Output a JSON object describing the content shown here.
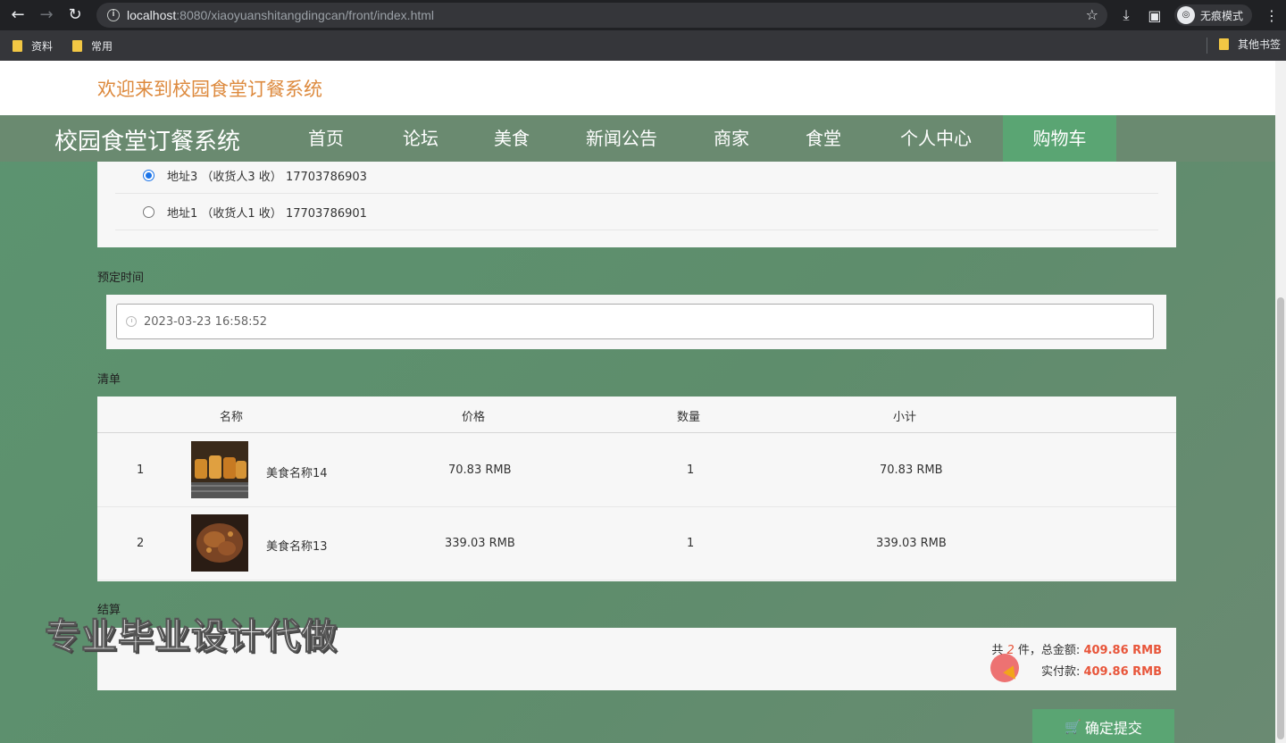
{
  "browser": {
    "url_host": "localhost",
    "url_rest": ":8080/xiaoyuanshitangdingcan/front/index.html",
    "incognito_label": "无痕模式",
    "bookmarks": [
      "资料",
      "常用"
    ],
    "other_bookmarks": "其他书签"
  },
  "header": {
    "welcome": "欢迎来到校园食堂订餐系统",
    "site_title": "校园食堂订餐系统",
    "nav": [
      "首页",
      "论坛",
      "美食",
      "新闻公告",
      "商家",
      "食堂",
      "个人中心",
      "购物车"
    ],
    "active_nav": "购物车"
  },
  "addresses": [
    {
      "text": "地址3 （收货人3 收） 17703786903",
      "selected": true
    },
    {
      "text": "地址1 （收货人1 收） 17703786901",
      "selected": false
    }
  ],
  "booking": {
    "label": "预定时间",
    "value": "2023-03-23 16:58:52"
  },
  "list": {
    "label": "清单",
    "headers": [
      "名称",
      "价格",
      "数量",
      "小计"
    ],
    "rows": [
      {
        "index": "1",
        "name": "美食名称14",
        "price": "70.83 RMB",
        "qty": "1",
        "subtotal": "70.83 RMB"
      },
      {
        "index": "2",
        "name": "美食名称13",
        "price": "339.03 RMB",
        "qty": "1",
        "subtotal": "339.03 RMB"
      }
    ]
  },
  "settle": {
    "label": "结算",
    "count_prefix": "共 ",
    "count": "2",
    "count_suffix": " 件，总金额: ",
    "total": "409.86 RMB",
    "paid_label": "实付款: ",
    "paid": "409.86 RMB"
  },
  "submit_label": "确定提交",
  "watermark": "专业毕业设计代做",
  "colors": {
    "accent": "#5aa573",
    "price": "#e8553a",
    "welcome": "#dd8a3e"
  }
}
